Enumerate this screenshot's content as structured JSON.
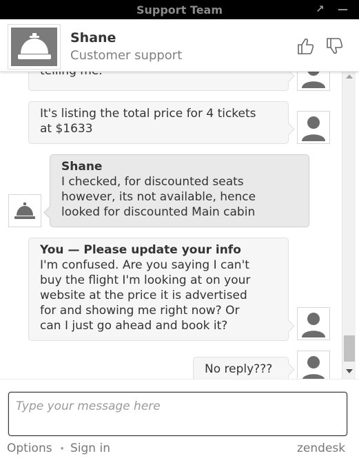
{
  "window": {
    "title": "Support Team",
    "popout_icon": "↗",
    "minimize_icon": "—"
  },
  "agent": {
    "name": "Shane",
    "role": "Customer support"
  },
  "messages": [
    {
      "from": "user",
      "lines": [
        "telling me."
      ]
    },
    {
      "from": "user",
      "lines": [
        "It's listing the total price for 4 tickets",
        "at $1633"
      ]
    },
    {
      "from": "agent",
      "sender": "Shane",
      "lines": [
        "I checked, for discounted seats",
        "however, its not available, hence",
        "looked for discounted Main cabin"
      ]
    },
    {
      "from": "user",
      "sender": "You — Please update your info",
      "lines": [
        "I'm confused.  Are you saying I can't",
        "buy the flight I'm looking at on your",
        "website at the price it is advertised",
        "for and showing me right now?  Or",
        "can I just go ahead and book it?"
      ]
    },
    {
      "from": "user",
      "lines": [
        "No reply???"
      ]
    }
  ],
  "composer": {
    "placeholder": "Type your message here"
  },
  "footer": {
    "options": "Options",
    "separator": "•",
    "signin": "Sign in",
    "brand": "zendesk"
  }
}
